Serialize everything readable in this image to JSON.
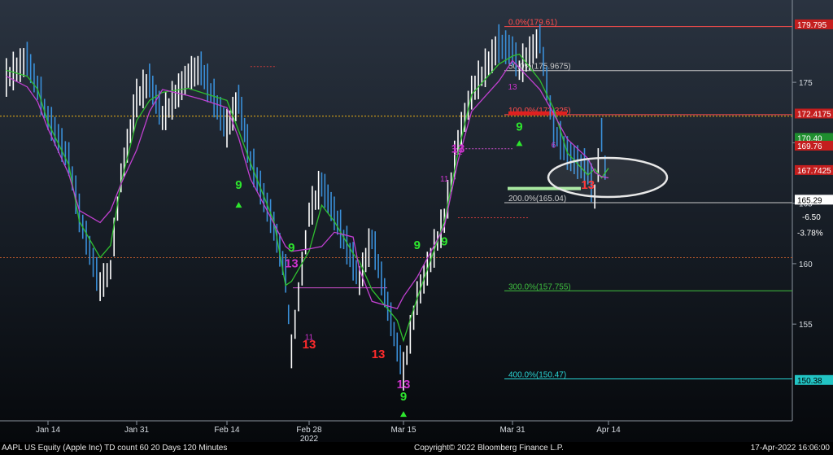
{
  "chart_data": {
    "type": "line",
    "security": "AAPL US Equity (Apple Inc)",
    "x_labels": [
      "Jan 14",
      "Jan 31",
      "Feb 14",
      "Feb 28",
      "Mar 15",
      "Mar 31",
      "Apr 14"
    ],
    "year_label": "2022",
    "y_ticks": [
      155,
      160,
      165,
      170,
      175
    ],
    "ylim": [
      147,
      181
    ],
    "price_series": {
      "name": "AAPL",
      "x": [
        "Jan 6",
        "Jan 10",
        "Jan 12",
        "Jan 14",
        "Jan 18",
        "Jan 20",
        "Jan 24",
        "Jan 26",
        "Jan 28",
        "Jan 31",
        "Feb 2",
        "Feb 4",
        "Feb 8",
        "Feb 10",
        "Feb 14",
        "Feb 16",
        "Feb 18",
        "Feb 22",
        "Feb 24",
        "Feb 25",
        "Feb 28",
        "Mar 2",
        "Mar 4",
        "Mar 7",
        "Mar 8",
        "Mar 10",
        "Mar 14",
        "Mar 15",
        "Mar 17",
        "Mar 21",
        "Mar 23",
        "Mar 25",
        "Mar 29",
        "Mar 31",
        "Apr 1",
        "Apr 4",
        "Apr 6",
        "Apr 8",
        "Apr 11",
        "Apr 12",
        "Apr 13",
        "Apr 14"
      ],
      "y": [
        175.2,
        176.8,
        174.5,
        172.0,
        168.5,
        164.0,
        158.0,
        159.5,
        167.0,
        173.5,
        175.0,
        172.0,
        175.5,
        176.0,
        171.0,
        173.5,
        168.5,
        163.0,
        159.0,
        152.6,
        164.0,
        166.5,
        164.0,
        160.0,
        158.5,
        162.0,
        153.0,
        150.9,
        157.0,
        163.5,
        170.0,
        174.0,
        178.0,
        177.5,
        176.0,
        178.5,
        171.0,
        169.0,
        167.5,
        165.5,
        170.5,
        165.29
      ]
    },
    "fib_levels": [
      {
        "label": "0.0%(179.61)",
        "value": 179.61,
        "color": "#ff4d4d"
      },
      {
        "label": "50.0%(175.9675)",
        "value": 175.9675,
        "color": "#c9c9c9"
      },
      {
        "label": "100.0%(172.325)",
        "value": 172.325,
        "color": "#ff4d4d"
      },
      {
        "label": "200.0%(165.04)",
        "value": 165.04,
        "color": "#c9c9c9"
      },
      {
        "label": "300.0%(157.755)",
        "value": 157.755,
        "color": "#3fbf3f"
      },
      {
        "label": "400.0%(150.47)",
        "value": 150.47,
        "color": "#29d3d3"
      }
    ],
    "right_tags": [
      {
        "text": "179.795",
        "value": 179.795,
        "bg": "#c41e1e",
        "fg": "#ffffff"
      },
      {
        "text": "172.4175",
        "value": 172.4175,
        "bg": "#c41e1e",
        "fg": "#ffffff"
      },
      {
        "text": "170.40",
        "value": 170.4,
        "bg": "#1f8f2f",
        "fg": "#ffffff"
      },
      {
        "text": "169.76",
        "value": 169.76,
        "bg": "#c41e1e",
        "fg": "#ffffff"
      },
      {
        "text": "167.7425",
        "value": 167.7425,
        "bg": "#c41e1e",
        "fg": "#ffffff"
      },
      {
        "text": "165.29",
        "value": 165.29,
        "bg": "#ffffff",
        "fg": "#000000"
      },
      {
        "text": "150.38",
        "value": 150.38,
        "bg": "#22c4c4",
        "fg": "#000000"
      }
    ],
    "change": {
      "abs": "-6.50",
      "pct": "-3.78%"
    },
    "td_counts": [
      {
        "text": "13",
        "x": "Feb 28",
        "y": 153.0,
        "color": "#ff2b2b",
        "size": "big"
      },
      {
        "text": "11",
        "x": "Feb 28",
        "y": 153.7,
        "color": "#cc33cc",
        "size": "small"
      },
      {
        "text": "13",
        "x": "Mar 15",
        "y": 149.7,
        "color": "#cc33cc",
        "size": "big"
      },
      {
        "text": "13",
        "x": "Mar 11",
        "y": 152.2,
        "color": "#ff2b2b",
        "size": "big"
      },
      {
        "text": "9",
        "x": "Mar 15",
        "y": 148.7,
        "color": "#2ee62e",
        "size": "big"
      },
      {
        "text": "9",
        "x": "Feb 16",
        "y": 166.2,
        "color": "#2ee62e",
        "size": "big"
      },
      {
        "text": "9",
        "x": "Feb 25",
        "y": 161.0,
        "color": "#2ee62e",
        "size": "big"
      },
      {
        "text": "13",
        "x": "Feb 25",
        "y": 159.7,
        "color": "#cc33cc",
        "size": "big"
      },
      {
        "text": "9",
        "x": "Mar 17",
        "y": 161.2,
        "color": "#2ee62e",
        "size": "big"
      },
      {
        "text": "9",
        "x": "Mar 21",
        "y": 161.5,
        "color": "#2ee62e",
        "size": "big"
      },
      {
        "text": "13",
        "x": "Mar 23",
        "y": 169.2,
        "color": "#cc33cc",
        "size": "big"
      },
      {
        "text": "9",
        "x": "Apr 1",
        "y": 171.0,
        "color": "#2ee62e",
        "size": "big"
      },
      {
        "text": "13",
        "x": "Apr 11",
        "y": 166.2,
        "color": "#ff2b2b",
        "size": "big"
      },
      {
        "text": "11",
        "x": "Mar 21",
        "y": 166.8,
        "color": "#cc33cc",
        "size": "small"
      },
      {
        "text": "12",
        "x": "Mar 23",
        "y": 169.0,
        "color": "#cc33cc",
        "size": "small"
      },
      {
        "text": "6",
        "x": "Apr 6",
        "y": 169.6,
        "color": "#cc33cc",
        "size": "small"
      },
      {
        "text": "13",
        "x": "Mar 31",
        "y": 174.4,
        "color": "#cc33cc",
        "size": "small"
      }
    ]
  },
  "footer": {
    "left": "AAPL US Equity (Apple Inc) TD count 60 20 Days 120 Minutes",
    "mid": "Copyright© 2022 Bloomberg Finance L.P.",
    "right": "17-Apr-2022 16:06:00"
  },
  "colors": {
    "price_up": "#ffffff",
    "price_down": "#3a8fd8",
    "ma_green": "#2fbf2f",
    "ma_magenta": "#c040d0",
    "orange_dotted": "#d6a21a",
    "red_dotted": "#c83a3a",
    "highlight_ellipse": "#e8e8e8"
  }
}
